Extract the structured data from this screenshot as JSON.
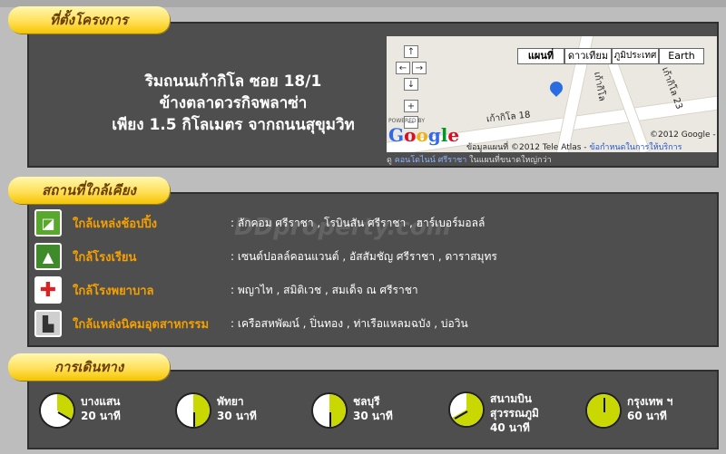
{
  "tabs": {
    "location": "ที่ตั้งโครงการ",
    "nearby": "สถานที่ใกล้เคียง",
    "travel": "การเดินทาง"
  },
  "address": {
    "line1": "ริมถนนเก้ากิโล ซอย 18/1",
    "line2": "ข้างตลาดวรกิจพลาซ่า",
    "line3": "เพียง 1.5 กิโลเมตร จากถนนสุขุมวิท"
  },
  "map": {
    "types": [
      "แผนที่",
      "ดาวเทียม",
      "ภูมิประเทศ",
      "Earth"
    ],
    "road_label_1": "เก้ากิโล 18",
    "road_label_2": "เก้ากิโล",
    "road_label_3": "เก้ากิโล 23",
    "powered": "POWERED BY",
    "google": "Google",
    "copyright": "©2012 Google -",
    "data_credit": "ข้อมูลแผนที่ ©2012 Tele Atlas -",
    "terms": "ข้อกำหนดในการให้บริการ",
    "link_prefix": "ดู",
    "link_text": "คอนโดไนน์ ศรีราชา",
    "link_suffix": "ในแผนที่ขนาดใหญ่กว่า"
  },
  "nearby": [
    {
      "label": "ใกล้แหล่งช้อปปิ้ง",
      "value": ":  ลักคอม ศรีราชา , โรบินสัน ศรีราชา , ฮาร์เบอร์มอลล์",
      "icon": "shopping-bag-icon",
      "color": "#57a82c"
    },
    {
      "label": "ใกล้โรงเรียน",
      "value": ":  เซนต์ปอลล์คอนแวนต์ , อัสสัมชัญ ศรีราชา , ดาราสมุทร",
      "icon": "school-bell-icon",
      "color": "#3f8a2a"
    },
    {
      "label": "ใกล้โรงพยาบาล",
      "value": ":  พญาไท , สมิติเวช , สมเด็จ ณ ศรีราชา",
      "icon": "hospital-cross-icon",
      "color": "#ffffff"
    },
    {
      "label": "ใกล้แหล่งนิคมอุตสาหกรรม",
      "value": ":  เครือสหพัฒน์ , ปิ่นทอง , ท่าเรือแหลมฉบัง , บ่อวิน",
      "icon": "factory-icon",
      "color": "#cfcfcf"
    }
  ],
  "watermark": "DDproperty.com",
  "travel": [
    {
      "place": "บางแสน",
      "time": "20 นาที",
      "minutes": 20
    },
    {
      "place": "พัทยา",
      "time": "30 นาที",
      "minutes": 30
    },
    {
      "place": "ชลบุรี",
      "time": "30 นาที",
      "minutes": 30
    },
    {
      "place": "สนามบิน สุวรรณภูมิ",
      "place_l1": "สนามบิน",
      "place_l2": "สุวรรณภูมิ",
      "time": "40 นาที",
      "minutes": 40
    },
    {
      "place": "กรุงเทพ ฯ",
      "time": "60 นาที",
      "minutes": 60
    }
  ],
  "colors": {
    "panel": "#4e4e4e",
    "tab": "#ffd21f",
    "accent_label": "#f4a000",
    "clock_fill": "#c8d800"
  }
}
